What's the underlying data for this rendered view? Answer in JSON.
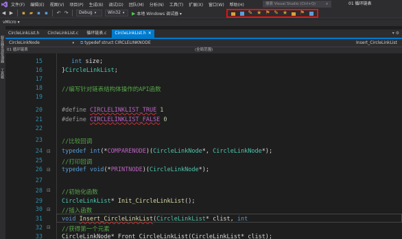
{
  "menubar": {
    "items": [
      "文件(F)",
      "编辑(E)",
      "视图(V)",
      "项目(P)",
      "生成(B)",
      "调试(D)",
      "团队(M)",
      "分析(N)",
      "工具(T)",
      "扩展(X)",
      "窗口(W)",
      "帮助(H)"
    ],
    "search_placeholder": "搜索 Visual Studio (Ctrl+Q)",
    "title": "01 循环链表"
  },
  "toolbar": {
    "config": "Debug",
    "platform": "Win32",
    "run_label": "本地 Windows 调试器"
  },
  "vmicro": {
    "label": "vMicro ▾"
  },
  "tabs": [
    {
      "label": "CircleLinkList.h",
      "active": false
    },
    {
      "label": "CircleLinkList.c",
      "active": false
    },
    {
      "label": "循环链表.c",
      "active": false
    },
    {
      "label": "CircleLinkList.h",
      "active": true
    }
  ],
  "navbar": {
    "left": "CircleLinkNode",
    "middle": "typedef struct CIRCLELINKNODE",
    "scope_right": "Insert_CircleLinkList"
  },
  "navbar2": {
    "project": "01 循环链表",
    "scope": "(全局范围)"
  },
  "leftstrip": [
    "服务器资源管理器",
    "工具箱"
  ],
  "editor": {
    "lines": [
      {
        "n": "15"
      },
      {
        "n": "16"
      },
      {
        "n": "17"
      },
      {
        "n": "18"
      },
      {
        "n": "19"
      },
      {
        "n": "20"
      },
      {
        "n": "21"
      },
      {
        "n": "22"
      },
      {
        "n": "23"
      },
      {
        "n": "24"
      },
      {
        "n": "25"
      },
      {
        "n": "26"
      },
      {
        "n": "27"
      },
      {
        "n": "28"
      },
      {
        "n": "29"
      },
      {
        "n": "30"
      },
      {
        "n": "31"
      },
      {
        "n": "32"
      },
      {
        "n": "33"
      }
    ],
    "code": {
      "l15_kw": "int",
      "l15_rest": " size;",
      "l16_brace": "}",
      "l16_name": "CircleLinkList",
      "l16_semi": ";",
      "l18": "//编写针对链表结构体操作的API函数",
      "l20_def": "#define ",
      "l20_macro": "CIRCLELINKLIST_TRUE",
      "l20_val": " 1",
      "l21_def": "#define ",
      "l21_macro": "CIRCLELINKLIST_FALSE",
      "l21_val": " 0",
      "l23": "//比较回调",
      "l24_a": "typedef ",
      "l24_b": "int",
      "l24_c": "(*",
      "l24_d": "COMPARENODE",
      "l24_e": ")(",
      "l24_f": "CircleLinkNode",
      "l24_g": "*, ",
      "l24_h": "CircleLinkNode",
      "l24_i": "*);",
      "l25": "//打印回调",
      "l26_a": "typedef ",
      "l26_b": "void",
      "l26_c": "(*",
      "l26_d": "PRINTNODE",
      "l26_e": ")(",
      "l26_f": "CircleLinkNode",
      "l26_g": "*);",
      "l28": "//初始化函数",
      "l29_a": "CircleLinkList",
      "l29_b": "* ",
      "l29_c": "Init_CircleLinkList",
      "l29_d": "();",
      "l30": "//插入函数",
      "l31_a": "void ",
      "l31_b": "Insert_CircleLinkList",
      "l31_c": "(",
      "l31_d": "CircleLinkList",
      "l31_e": "* clist, ",
      "l31_f": "int",
      "l32": "//获得第一个元素",
      "l33": "CircleLinkNode* Front_CircleLinkList(CircleLinkList* clist);"
    }
  }
}
